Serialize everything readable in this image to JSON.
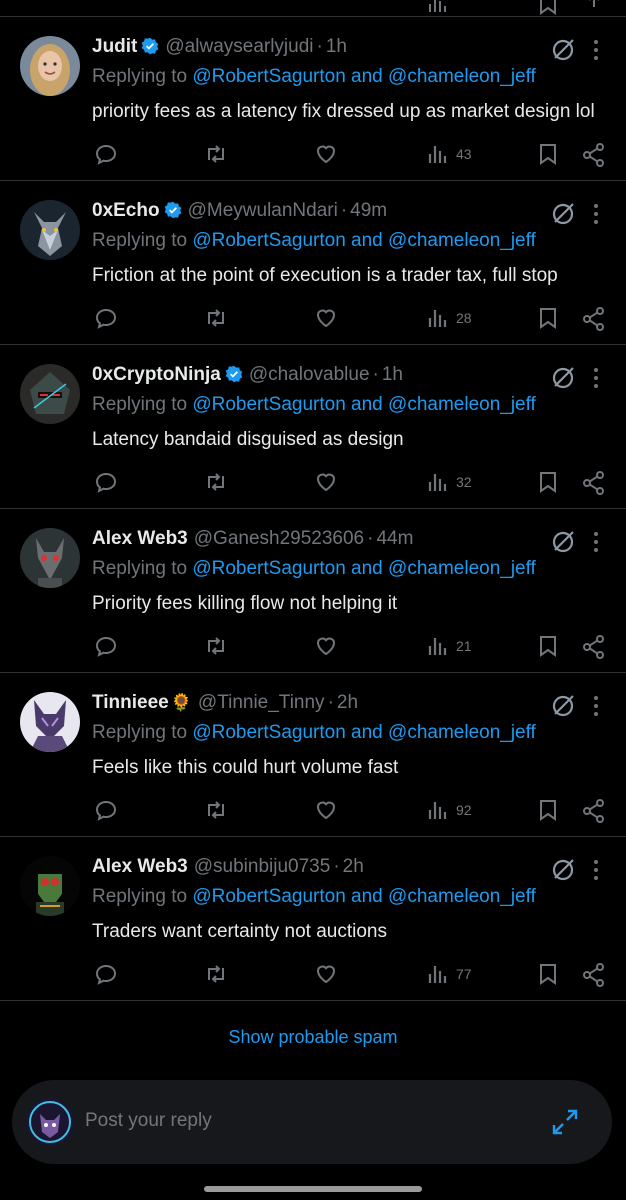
{
  "tweets": [
    {
      "name": "Judit",
      "verified": true,
      "emoji": "",
      "handle": "@alwaysearlyjudi",
      "time": "1h",
      "replying_prefix": "Replying to ",
      "replying_link": "@RobertSagurton and @chameleon_jeff",
      "text": "priority fees as a latency fix dressed up as market design lol",
      "views": "43"
    },
    {
      "name": "0xEcho",
      "verified": true,
      "emoji": "",
      "handle": "@MeywulanNdari",
      "time": "49m",
      "replying_prefix": "Replying to ",
      "replying_link": "@RobertSagurton and @chameleon_jeff",
      "text": "Friction at the point of execution is a trader tax, full stop",
      "views": "28"
    },
    {
      "name": "0xCryptoNinja",
      "verified": true,
      "emoji": "",
      "handle": "@chalovablue",
      "time": "1h",
      "replying_prefix": "Replying to ",
      "replying_link": "@RobertSagurton and @chameleon_jeff",
      "text": "Latency bandaid disguised as design",
      "views": "32"
    },
    {
      "name": "Alex Web3",
      "verified": false,
      "emoji": "",
      "handle": "@Ganesh29523606",
      "time": "44m",
      "replying_prefix": "Replying to ",
      "replying_link": "@RobertSagurton and @chameleon_jeff",
      "text": "Priority fees killing flow not helping it",
      "views": "21"
    },
    {
      "name": "Tinnieee",
      "verified": false,
      "emoji": "🌻",
      "handle": "@Tinnie_Tinny",
      "time": "2h",
      "replying_prefix": "Replying to ",
      "replying_link": "@RobertSagurton and @chameleon_jeff",
      "text": "Feels like this could hurt volume fast",
      "views": "92"
    },
    {
      "name": "Alex Web3",
      "verified": false,
      "emoji": "",
      "handle": "@subinbiju0735",
      "time": "2h",
      "replying_prefix": "Replying to ",
      "replying_link": "@RobertSagurton and @chameleon_jeff",
      "text": "Traders want certainty not auctions",
      "views": "77"
    }
  ],
  "spam_label": "Show probable spam",
  "composer": {
    "placeholder": "Post your reply"
  },
  "colors": {
    "accent": "#1d9bf0",
    "muted": "#71767b",
    "text": "#e7e9ea",
    "border": "#2f3336",
    "background": "#000000"
  }
}
